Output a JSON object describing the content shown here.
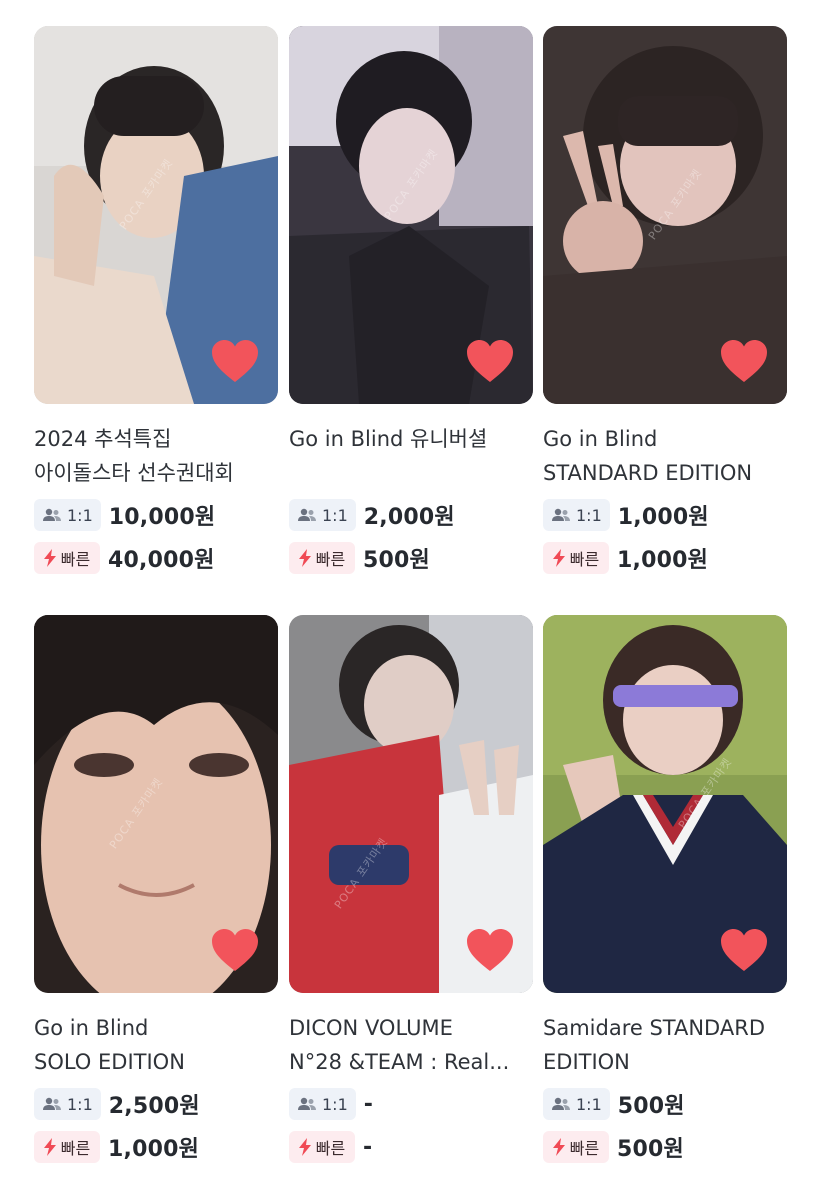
{
  "icons": {
    "trade": "users-icon",
    "fast": "lightning-icon",
    "like": "heart-icon"
  },
  "colors": {
    "heart": "#f2545b",
    "lightning": "#f04a55",
    "trade_badge_bg": "#eef2f8",
    "fast_badge_bg": "#fdecef"
  },
  "items": [
    {
      "title_lines": [
        "2024 추석특집",
        "아이돌스타 선수권대회"
      ],
      "trade_label": "1:1",
      "trade_price": "10,000원",
      "fast_label": "빠른",
      "fast_price": "40,000원",
      "watermark": "POCA 포카마켓"
    },
    {
      "title_lines": [
        "Go in Blind 유니버셜",
        ""
      ],
      "trade_label": "1:1",
      "trade_price": "2,000원",
      "fast_label": "빠른",
      "fast_price": "500원",
      "watermark": "POCA 포카마켓"
    },
    {
      "title_lines": [
        "Go in Blind",
        "STANDARD EDITION"
      ],
      "trade_label": "1:1",
      "trade_price": "1,000원",
      "fast_label": "빠른",
      "fast_price": "1,000원",
      "watermark": "POCA 포카마켓"
    },
    {
      "title_lines": [
        "Go in Blind",
        "SOLO EDITION"
      ],
      "trade_label": "1:1",
      "trade_price": "2,500원",
      "fast_label": "빠른",
      "fast_price": "1,000원",
      "watermark": "POCA 포카마켓"
    },
    {
      "title_lines": [
        "DICON VOLUME",
        "N°28 &TEAM : Real..."
      ],
      "trade_label": "1:1",
      "trade_price": "-",
      "fast_label": "빠른",
      "fast_price": "-",
      "watermark": "POCA 포카마켓"
    },
    {
      "title_lines": [
        "Samidare STANDARD",
        "EDITION"
      ],
      "trade_label": "1:1",
      "trade_price": "500원",
      "fast_label": "빠른",
      "fast_price": "500원",
      "watermark": "POCA 포카마켓"
    }
  ]
}
